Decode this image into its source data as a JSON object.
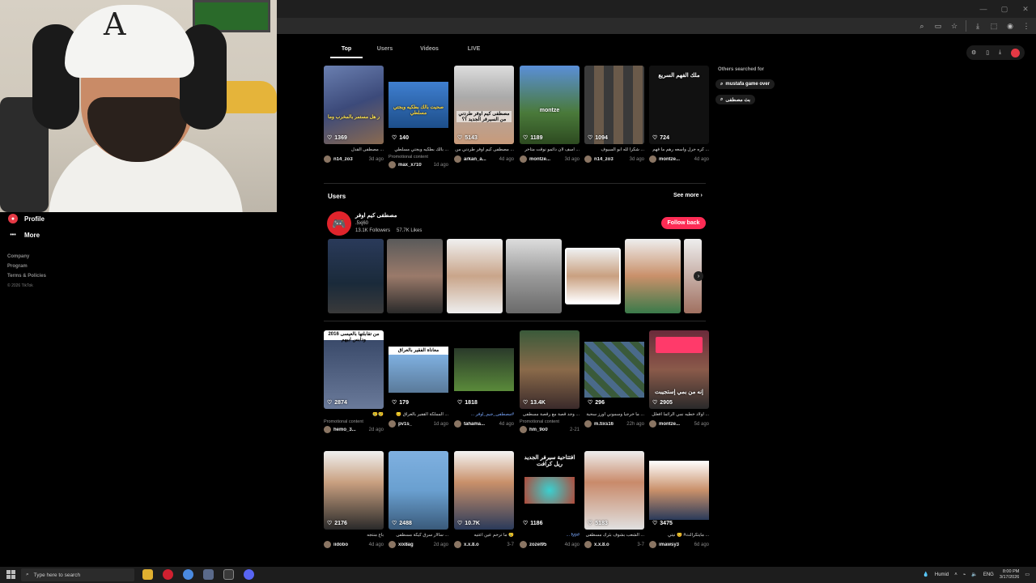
{
  "browser": {
    "window_controls": [
      "—",
      "▢",
      "✕"
    ],
    "toolbar_icons": [
      "search-icon",
      "cast-icon",
      "star-icon",
      "download-icon",
      "extensions-icon",
      "profile-icon",
      "menu-icon"
    ]
  },
  "tabs": [
    {
      "label": "Top",
      "active": true
    },
    {
      "label": "Users",
      "active": false
    },
    {
      "label": "Videos",
      "active": false
    },
    {
      "label": "LIVE",
      "active": false
    }
  ],
  "sidebar": {
    "profile_label": "Profile",
    "more_label": "More",
    "footer_links": [
      "Company",
      "Program",
      "Terms & Policies"
    ],
    "copyright": "© 2026 TikTok"
  },
  "related": {
    "title": "Others searched for",
    "items": [
      "mustafa game over",
      "بث مصطفى"
    ]
  },
  "row1": [
    {
      "likes": "1369",
      "caption": "... مصطفى القدل",
      "user": "n14_zo3",
      "date": "3d ago",
      "promo": "",
      "overlay": "ر هل مستمر بالمخرب وما"
    },
    {
      "likes": "140",
      "caption": "... بالك بطكيه ويجتي مسلطي",
      "user": "max_x710",
      "date": "1d ago",
      "promo": "Promotional content",
      "overlay": "صحيت بالك بطكيه ويجتي مسلطي"
    },
    {
      "likes": "5143",
      "caption": "... مصطفى كيم اوفر طردني من",
      "user": "arkan_a...",
      "date": "4d ago",
      "promo": "",
      "overlay": "مصطفى كيم اوفر طردني من السيرفر الجديد ؟؟"
    },
    {
      "likes": "1189",
      "caption": "... اسف لان دائمو نوقت متأخر",
      "user": "montze...",
      "date": "3d ago",
      "promo": "",
      "overlay": "montze"
    },
    {
      "likes": "1094",
      "caption": "... شكرا لله ابو السيوف",
      "user": "n14_zo3",
      "date": "3d ago",
      "promo": "",
      "overlay": ""
    },
    {
      "likes": "724",
      "caption": "... كره جرل واسعه رهم ما فهم",
      "user": "montze...",
      "date": "4d ago",
      "promo": "",
      "overlay": "ملك الفهم السريع"
    }
  ],
  "users_section": {
    "title": "Users",
    "see_more": "See more",
    "name": "مصطفى كيم اوفر",
    "handle": ".5xj60",
    "followers": "13.1K Followers",
    "likes": "57.7K Likes",
    "follow_back": "Follow back"
  },
  "row2": [
    {
      "likes": "2874",
      "caption": "😢😢",
      "user": "hemo_3...",
      "date": "2d ago",
      "promo": "Promotional content",
      "overlay": "من تقابلتها بالعيسى 2016 ودابس ابيهم"
    },
    {
      "likes": "179",
      "caption": "... المملكة القفير بالعراق 😔",
      "user": "pv1s_",
      "date": "1d ago",
      "promo": "",
      "overlay": "معاناة الفقير بالعراق"
    },
    {
      "likes": "1818",
      "caption": "#مصطفى_جيم_اوفر ...",
      "user": "tahama...",
      "date": "4d ago",
      "promo": "",
      "overlay": ""
    },
    {
      "likes": "13.4K",
      "caption": "... وجد قصة مع رقصة مسطفى",
      "user": "hm_9o0",
      "date": "2-21",
      "promo": "Promotional content",
      "overlay": ""
    },
    {
      "likes": "296",
      "caption": "... ما خرجيا وسموني اورز سحية",
      "user": "m.tixs16",
      "date": "22h ago",
      "promo": "",
      "overlay": ""
    },
    {
      "likes": "2905",
      "caption": "... اولاد خطيه نمي الرائما افعلل",
      "user": "montze...",
      "date": "5d ago",
      "promo": "",
      "overlay": "إنه من بمي إستجيبت"
    }
  ],
  "row3": [
    {
      "likes": "2176",
      "caption": "باع منتجه",
      "user": "iidobo",
      "date": "4d ago",
      "promo": "",
      "overlay": ""
    },
    {
      "likes": "2488",
      "caption": "... سالار سرق كيكة مسطفى",
      "user": "xix8ag",
      "date": "2d ago",
      "promo": "",
      "overlay": ""
    },
    {
      "likes": "10.7K",
      "caption": "😢 ما ترحم عين اعتيه",
      "user": "x.x.8.o",
      "date": "3-7",
      "promo": "",
      "overlay": ""
    },
    {
      "likes": "1186",
      "caption": "#fyp ...",
      "user": "zozel95",
      "date": "4d ago",
      "promo": "",
      "overlay": "افتتاحية سيرفر الجديد ريل كرافت"
    },
    {
      "likes": "5183",
      "caption": "... الشعب بشوف بثرك مسطفى",
      "user": "x.x.8.o",
      "date": "3-7",
      "promo": "",
      "overlay": ""
    },
    {
      "likes": "3475",
      "caption": "... مايتكرالث# 😊 نيتي",
      "user": "imawsy3",
      "date": "6d ago",
      "promo": "",
      "overlay": ""
    }
  ],
  "taskbar": {
    "search_placeholder": "Type here to search",
    "weather": "Humid",
    "lang": "ENG",
    "time": "8:00 PM",
    "date": "3/17/2026"
  },
  "colors": {
    "follow": "#fe2c55",
    "background": "#000000"
  }
}
